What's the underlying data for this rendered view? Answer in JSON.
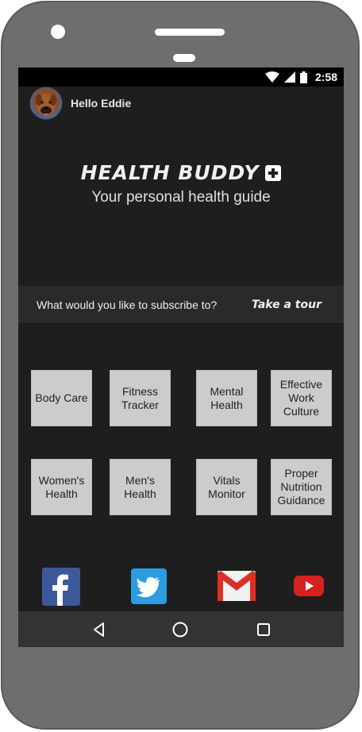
{
  "status_bar": {
    "time": "2:58",
    "icons": [
      "wifi-icon",
      "signal-icon",
      "battery-icon"
    ]
  },
  "header": {
    "greeting": "Hello Eddie",
    "avatar": "dog-avatar"
  },
  "brand": {
    "title": "HEALTH BUDDY",
    "icon": "plus-icon",
    "subtitle": "Your personal health guide"
  },
  "subscribe": {
    "question": "What would you like to subscribe to?",
    "tour_label": "Take a tour"
  },
  "categories": [
    {
      "label": "Body Care"
    },
    {
      "label": "Fitness Tracker"
    },
    {
      "label": "Mental Health"
    },
    {
      "label": "Effective Work Culture"
    },
    {
      "label": "Women's Health"
    },
    {
      "label": "Men's Health"
    },
    {
      "label": "Vitals Monitor"
    },
    {
      "label": "Proper Nutrition Guidance"
    }
  ],
  "social": [
    "facebook-icon",
    "twitter-icon",
    "gmail-icon",
    "youtube-icon"
  ],
  "navbar": [
    "back-icon",
    "home-icon",
    "recents-icon"
  ],
  "colors": {
    "screen_bg": "#1e1e1e",
    "tile_bg": "#cccccc",
    "bar_bg": "#2a2a2a",
    "nav_bg": "#333333"
  }
}
